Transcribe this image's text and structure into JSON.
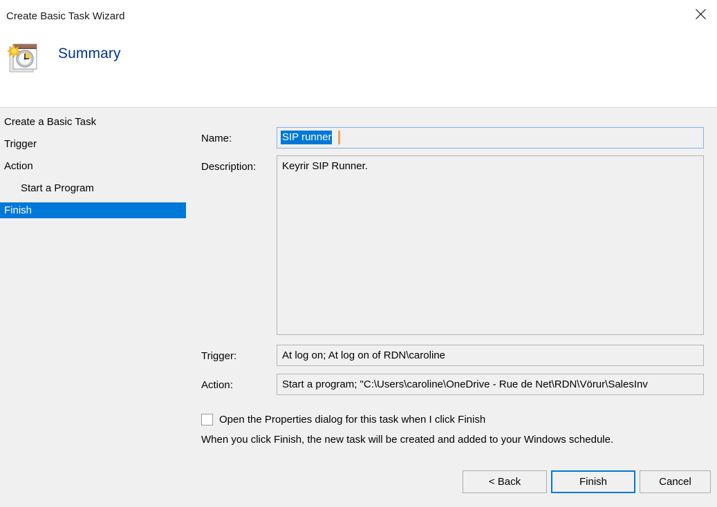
{
  "window": {
    "title": "Create Basic Task Wizard",
    "close_icon": "close-icon"
  },
  "header": {
    "title": "Summary",
    "icon": "task-scheduler-calendar-clock-icon"
  },
  "sidebar": {
    "items": [
      {
        "label": "Create a Basic Task",
        "indent": false,
        "selected": false
      },
      {
        "label": "Trigger",
        "indent": false,
        "selected": false
      },
      {
        "label": "Action",
        "indent": false,
        "selected": false
      },
      {
        "label": "Start a Program",
        "indent": true,
        "selected": false
      },
      {
        "label": "Finish",
        "indent": false,
        "selected": true
      }
    ],
    "selection_color": "#0078d7"
  },
  "form": {
    "name_label": "Name:",
    "name_value": "SIP runner",
    "name_selected": true,
    "description_label": "Description:",
    "description_value": "Keyrir SIP Runner.",
    "trigger_label": "Trigger:",
    "trigger_value": "At log on; At log on of RDN\\caroline",
    "action_label": "Action:",
    "action_value": "Start a program; \"C:\\Users\\caroline\\OneDrive - Rue de Net\\RDN\\Vörur\\SalesInv"
  },
  "options": {
    "open_properties_label": "Open the Properties dialog for this task when I click Finish",
    "open_properties_checked": false,
    "note": "When you click Finish, the new task will be created and added to your Windows schedule."
  },
  "footer": {
    "back_label": "< Back",
    "finish_label": "Finish",
    "cancel_label": "Cancel",
    "default_button": "Finish",
    "focus_color": "#0078d7"
  }
}
